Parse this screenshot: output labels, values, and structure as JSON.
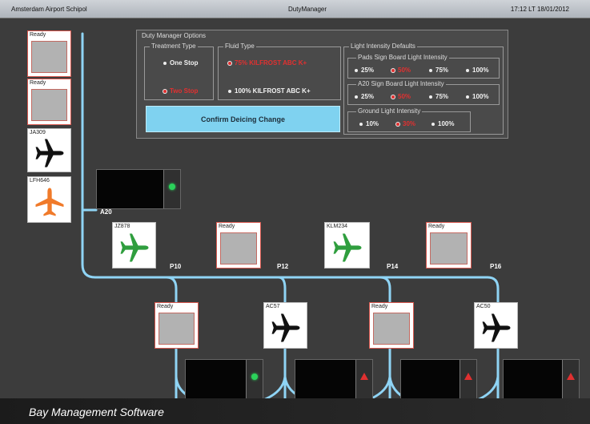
{
  "window": {
    "location": "Amsterdam Airport Schipol",
    "app_title": "DutyManager",
    "clock": "17:12 LT  18/01/2012"
  },
  "options_panel": {
    "title": "Duty Manager Options",
    "treatment_type": {
      "title": "Treatment Type",
      "options": [
        {
          "label": "One Stop",
          "selected": false
        },
        {
          "label": "Two Stop",
          "selected": true
        }
      ]
    },
    "fluid_type": {
      "title": "Fluid Type",
      "options": [
        {
          "label": "75% KILFROST ABC K+",
          "selected": true
        },
        {
          "label": "100% KILFROST ABC K+",
          "selected": false
        }
      ]
    },
    "confirm_button": "Confirm Deicing Change",
    "light_defaults": {
      "title": "Light Intensity Defaults",
      "pads": {
        "title": "Pads Sign Board Light Intensity",
        "options": [
          {
            "label": "25%",
            "selected": false
          },
          {
            "label": "50%",
            "selected": true
          },
          {
            "label": "75%",
            "selected": false
          },
          {
            "label": "100%",
            "selected": false
          }
        ]
      },
      "a20": {
        "title": "A20 Sign Board Light Intensity",
        "options": [
          {
            "label": "25%",
            "selected": false
          },
          {
            "label": "50%",
            "selected": true
          },
          {
            "label": "75%",
            "selected": false
          },
          {
            "label": "100%",
            "selected": false
          }
        ]
      },
      "ground": {
        "title": "Ground Light Intensity",
        "options": [
          {
            "label": "10%",
            "selected": false
          },
          {
            "label": "30%",
            "selected": true
          },
          {
            "label": "100%",
            "selected": false
          }
        ]
      }
    }
  },
  "queue": [
    {
      "label": "Ready",
      "plane": "none"
    },
    {
      "label": "Ready",
      "plane": "none"
    },
    {
      "label": "JA309",
      "plane": "black"
    },
    {
      "label": "LFH646",
      "plane": "orange"
    }
  ],
  "a20": {
    "label": "A20",
    "status": "green"
  },
  "upper_pads": [
    {
      "label": "JZ878",
      "plane": "green",
      "gate": "P10"
    },
    {
      "label": "Ready",
      "plane": "none",
      "gate": "P12"
    },
    {
      "label": "KLM234",
      "plane": "green",
      "gate": "P14"
    },
    {
      "label": "Ready",
      "plane": "none",
      "gate": "P16"
    }
  ],
  "lower_pads": [
    {
      "label": "Ready",
      "plane": "none",
      "status": "green"
    },
    {
      "label": "AC57",
      "plane": "black",
      "status": "red"
    },
    {
      "label": "Ready",
      "plane": "none",
      "status": "red"
    },
    {
      "label": "AC50",
      "plane": "black",
      "status": "red"
    }
  ],
  "colors": {
    "pipe": "#8fd4f5",
    "plane_green": "#2f9e3e",
    "plane_orange": "#f07a2a",
    "plane_black": "#111111",
    "selected": "#e23030",
    "confirm_bg": "#7fd2f0"
  },
  "banner": "Bay Management Software"
}
